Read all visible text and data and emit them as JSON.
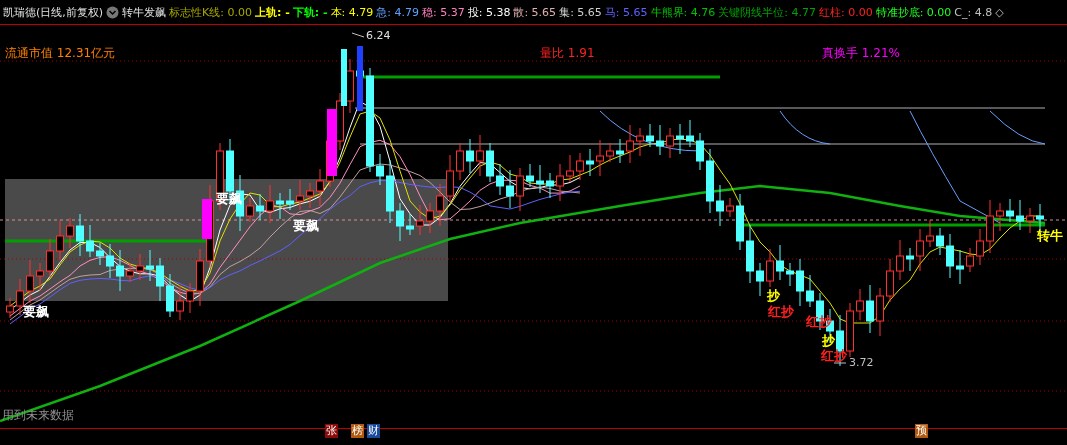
{
  "header": {
    "title": "凯瑞德(日线,前复权)",
    "formula": "转牛发飙",
    "menu_symbol": "◇",
    "indicators": [
      {
        "text": "标志性K线: 0.00",
        "color": "#a8a800"
      },
      {
        "text": "上轨: -",
        "color": "#ffff00"
      },
      {
        "text": "下轨: -",
        "color": "#00ff00"
      },
      {
        "text": "本: 4.79",
        "color": "#ffff00"
      },
      {
        "text": "急: 4.79",
        "color": "#5fa0ff"
      },
      {
        "text": "稳: 5.37",
        "color": "#ff80c0"
      },
      {
        "text": "投: 5.38",
        "color": "#ffffff"
      },
      {
        "text": "散: 5.65",
        "color": "#e0b0b0"
      },
      {
        "text": "集: 5.65",
        "color": "#d0d0d0"
      },
      {
        "text": "马: 5.65",
        "color": "#6060ff"
      },
      {
        "text": "牛熊界: 4.76",
        "color": "#00c000"
      },
      {
        "text": "关键阴线半位: 4.77",
        "color": "#00a000"
      },
      {
        "text": "红柱: 0.00",
        "color": "#ff2020"
      },
      {
        "text": "特准抄底: 0.00",
        "color": "#20ff20"
      },
      {
        "text": "C_: 4.8",
        "color": "#c0c0c0"
      }
    ]
  },
  "chart": {
    "infos": [
      {
        "text": "流通市值 12.31亿元",
        "color": "#ff8000"
      },
      {
        "text": "量比 1.91",
        "color": "#ff2020"
      },
      {
        "text": "真换手 1.21%",
        "color": "#ff00ff"
      }
    ],
    "high_mark": "6.24",
    "low_mark": "3.72",
    "signals": [
      {
        "text": "要飙",
        "color": "#ffffff"
      },
      {
        "text": "要飙",
        "color": "#ffffff"
      },
      {
        "text": "要飙",
        "color": "#ffffff"
      },
      {
        "text": "抄",
        "color": "#ffff00"
      },
      {
        "text": "红抄",
        "color": "#ff2020"
      },
      {
        "text": "红抄",
        "color": "#ff2020"
      },
      {
        "text": "抄",
        "color": "#ffff00"
      },
      {
        "text": "红抄",
        "color": "#ff2020"
      },
      {
        "text": "转牛",
        "color": "#ffff00"
      }
    ],
    "notice": "用到未来数据",
    "badges": [
      {
        "text": "张",
        "color": "#8a0a0a"
      },
      {
        "text": "榜",
        "color": "#b05a10"
      },
      {
        "text": "财",
        "color": "#1a4a9a"
      },
      {
        "text": "预",
        "color": "#b05a10"
      }
    ]
  }
}
